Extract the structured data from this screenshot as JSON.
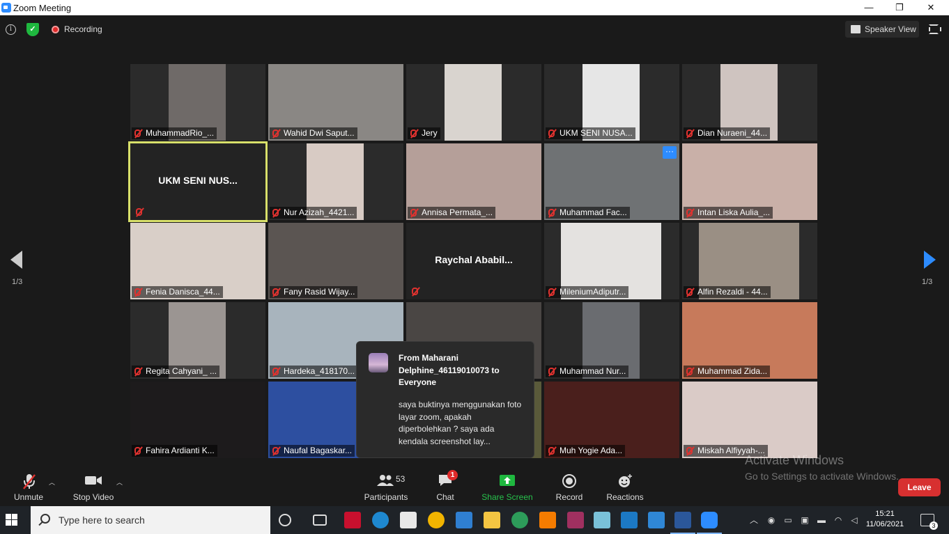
{
  "window": {
    "title": "Zoom Meeting",
    "minimize": "—",
    "maximize": "❐",
    "close": "✕"
  },
  "topbar": {
    "recording": "Recording",
    "view": "Speaker View"
  },
  "tiles": [
    {
      "name": "MuhammadRio_...",
      "bg": "#2b2b2b",
      "video": "#6f6a68"
    },
    {
      "name": "Wahid Dwi Saput...",
      "bg": "#8a8784",
      "video": "#8a8784"
    },
    {
      "name": "Jery",
      "bg": "#2b2b2b",
      "video": "#d9d4cf"
    },
    {
      "name": "UKM SENI NUSA...",
      "bg": "#2b2b2b",
      "video": "#e6e6e6"
    },
    {
      "name": "Dian Nuraeni_44...",
      "bg": "#2b2b2b",
      "video": "#cfc4c0"
    },
    {
      "name": "UKM SENI NUS...",
      "bg": "#232323",
      "video": "",
      "nameOnly": true,
      "active": true
    },
    {
      "name": "Nur Azizah_4421...",
      "bg": "#2b2b2b",
      "video": "#d8cbc4"
    },
    {
      "name": "Annisa Permata_...",
      "bg": "#b59f99",
      "video": "#b59f99"
    },
    {
      "name": "Muhammad Fac...",
      "bg": "#6f7274",
      "video": "#6f7274",
      "more": true
    },
    {
      "name": "Intan Liska Aulia_...",
      "bg": "#c9b0a8",
      "video": "#c9b0a8"
    },
    {
      "name": "Fenia Danisca_44...",
      "bg": "#d9cfc8",
      "video": "#d9cfc8"
    },
    {
      "name": "Fany Rasid Wijay...",
      "bg": "#5b5552",
      "video": "#5b5552"
    },
    {
      "name": "Raychal  Ababil...",
      "bg": "#232323",
      "video": "",
      "nameOnly": true
    },
    {
      "name": "MileniumAdiputr...",
      "bg": "#2b2b2b",
      "video": "#e4e2e0"
    },
    {
      "name": "Alfin Rezaldi - 44...",
      "bg": "#2b2b2b",
      "video": "#9a8f84"
    },
    {
      "name": "Regita Cahyani_ ...",
      "bg": "#2b2b2b",
      "video": "#9b9592"
    },
    {
      "name": "Hardeka_418170...",
      "bg": "#a8b4bd",
      "video": "#a8b4bd"
    },
    {
      "name": "",
      "bg": "#4a4644",
      "video": "#4a4644"
    },
    {
      "name": "Muhammad Nur...",
      "bg": "#2b2b2b",
      "video": "#6a6c70"
    },
    {
      "name": "Muhammad Zida...",
      "bg": "#c77a5b",
      "video": "#c77a5b"
    },
    {
      "name": "Fahira Ardianti K...",
      "bg": "#1d1b1c",
      "video": "#1d1b1c"
    },
    {
      "name": "Naufal Bagaskar...",
      "bg": "#2d4fa0",
      "video": "#2d4fa0"
    },
    {
      "name": "",
      "bg": "#5a5a3a",
      "video": "#5a5a3a"
    },
    {
      "name": "Muh Yogie Ada...",
      "bg": "#4a1f1c",
      "video": "#4a1f1c"
    },
    {
      "name": "Miskah Alfiyyah-...",
      "bg": "#dacbc7",
      "video": "#dacbc7"
    }
  ],
  "pager": {
    "left": "1/3",
    "right": "1/3"
  },
  "chat": {
    "from": "From Maharani Delphine_46119010073 to Everyone",
    "message": "saya buktinya menggunakan foto layar zoom, apakah diperbolehkan ? saya ada kendala screenshot lay..."
  },
  "toolbar": {
    "unmute": "Unmute",
    "stop_video": "Stop Video",
    "participants": "Participants",
    "participants_count": "53",
    "chat": "Chat",
    "chat_badge": "1",
    "share": "Share Screen",
    "record": "Record",
    "reactions": "Reactions",
    "leave": "Leave"
  },
  "watermark": {
    "line1": "Activate Windows",
    "line2": "Go to Settings to activate Windows."
  },
  "taskbar": {
    "search_placeholder": "Type here to search",
    "time": "15:21",
    "date": "11/06/2021",
    "notifications": "3"
  }
}
